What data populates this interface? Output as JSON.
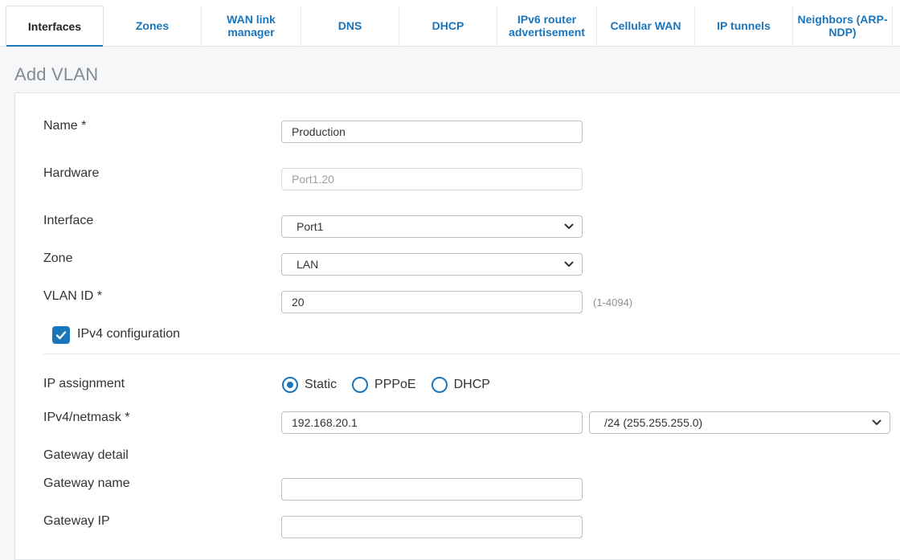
{
  "tabs": [
    {
      "label": "Interfaces"
    },
    {
      "label": "Zones"
    },
    {
      "label": "WAN link manager"
    },
    {
      "label": "DNS"
    },
    {
      "label": "DHCP"
    },
    {
      "label": "IPv6 router advertisement"
    },
    {
      "label": "Cellular WAN"
    },
    {
      "label": "IP tunnels"
    },
    {
      "label": "Neighbors (ARP-NDP)"
    }
  ],
  "active_tab": "Interfaces",
  "page": {
    "title": "Add VLAN"
  },
  "form": {
    "name": {
      "label": "Name *",
      "value": "Production"
    },
    "hardware": {
      "label": "Hardware",
      "value": "Port1.20"
    },
    "interface": {
      "label": "Interface",
      "value": "Port1"
    },
    "zone": {
      "label": "Zone",
      "value": "LAN"
    },
    "vlan_id": {
      "label": "VLAN ID *",
      "value": "20",
      "hint": "(1-4094)"
    },
    "ipv4_config": {
      "label": "IPv4 configuration",
      "checked": true
    },
    "ip_assignment": {
      "label": "IP assignment",
      "options": [
        "Static",
        "PPPoE",
        "DHCP"
      ],
      "selected": "Static"
    },
    "ipv4_netmask": {
      "label": "IPv4/netmask *",
      "ip": "192.168.20.1",
      "netmask": "/24 (255.255.255.0)"
    },
    "gateway_detail": {
      "label": "Gateway detail"
    },
    "gateway_name": {
      "label": "Gateway name",
      "value": ""
    },
    "gateway_ip": {
      "label": "Gateway IP",
      "value": ""
    }
  },
  "colors": {
    "accent": "#1b75bb",
    "muted_text": "#8a9097",
    "border": "#b9bfc6"
  },
  "icons": {
    "select": "chevron-down-icon",
    "checkbox": "check-icon"
  }
}
